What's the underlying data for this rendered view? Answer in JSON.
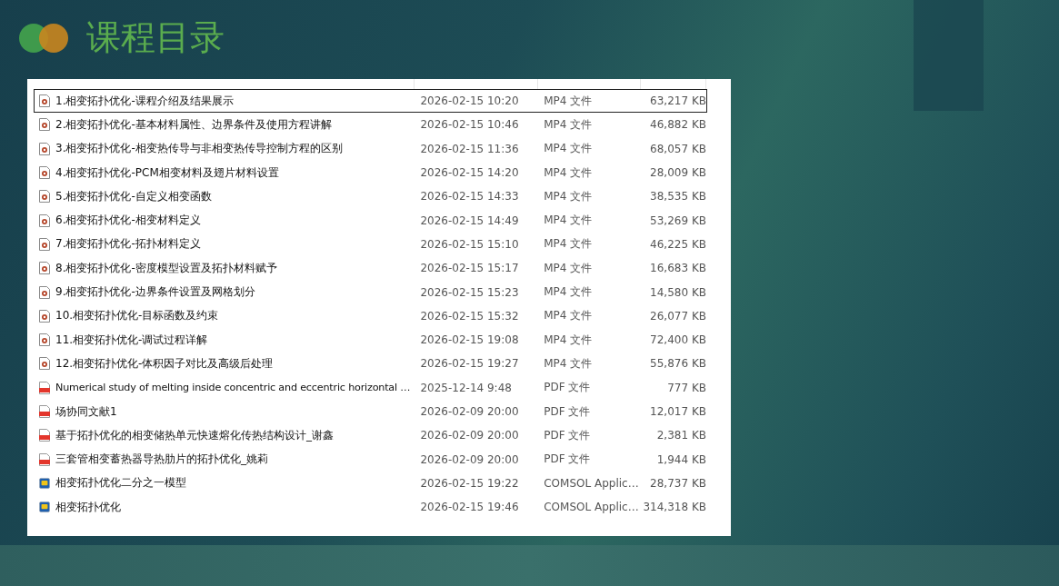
{
  "slide": {
    "title": "课程目录"
  },
  "file_list": {
    "rows": [
      {
        "kind": "mp4",
        "name": "1.相变拓扑优化-课程介绍及结果展示",
        "modified": "2026-02-15 10:20",
        "type": "MP4 文件",
        "size": "63,217 KB",
        "selected": true
      },
      {
        "kind": "mp4",
        "name": "2.相变拓扑优化-基本材料属性、边界条件及使用方程讲解",
        "modified": "2026-02-15 10:46",
        "type": "MP4 文件",
        "size": "46,882 KB",
        "selected": false
      },
      {
        "kind": "mp4",
        "name": "3.相变拓扑优化-相变热传导与非相变热传导控制方程的区别",
        "modified": "2026-02-15 11:36",
        "type": "MP4 文件",
        "size": "68,057 KB",
        "selected": false
      },
      {
        "kind": "mp4",
        "name": "4.相变拓扑优化-PCM相变材料及翅片材料设置",
        "modified": "2026-02-15 14:20",
        "type": "MP4 文件",
        "size": "28,009 KB",
        "selected": false
      },
      {
        "kind": "mp4",
        "name": "5.相变拓扑优化-自定义相变函数",
        "modified": "2026-02-15 14:33",
        "type": "MP4 文件",
        "size": "38,535 KB",
        "selected": false
      },
      {
        "kind": "mp4",
        "name": "6.相变拓扑优化-相变材料定义",
        "modified": "2026-02-15 14:49",
        "type": "MP4 文件",
        "size": "53,269 KB",
        "selected": false
      },
      {
        "kind": "mp4",
        "name": "7.相变拓扑优化-拓扑材料定义",
        "modified": "2026-02-15 15:10",
        "type": "MP4 文件",
        "size": "46,225 KB",
        "selected": false
      },
      {
        "kind": "mp4",
        "name": "8.相变拓扑优化-密度模型设置及拓扑材料赋予",
        "modified": "2026-02-15 15:17",
        "type": "MP4 文件",
        "size": "16,683 KB",
        "selected": false
      },
      {
        "kind": "mp4",
        "name": "9.相变拓扑优化-边界条件设置及网格划分",
        "modified": "2026-02-15 15:23",
        "type": "MP4 文件",
        "size": "14,580 KB",
        "selected": false
      },
      {
        "kind": "mp4",
        "name": "10.相变拓扑优化-目标函数及约束",
        "modified": "2026-02-15 15:32",
        "type": "MP4 文件",
        "size": "26,077 KB",
        "selected": false
      },
      {
        "kind": "mp4",
        "name": "11.相变拓扑优化-调试过程详解",
        "modified": "2026-02-15 19:08",
        "type": "MP4 文件",
        "size": "72,400 KB",
        "selected": false
      },
      {
        "kind": "mp4",
        "name": "12.相变拓扑优化-体积因子对比及高级后处理",
        "modified": "2026-02-15 19:27",
        "type": "MP4 文件",
        "size": "55,876 KB",
        "selected": false
      },
      {
        "kind": "pdf",
        "name": "Numerical study of melting inside concentric and eccentric horizontal …",
        "modified": "2025-12-14 9:48",
        "type": "PDF 文件",
        "size": "777 KB",
        "selected": false
      },
      {
        "kind": "pdf",
        "name": "场协同文献1",
        "modified": "2026-02-09 20:00",
        "type": "PDF 文件",
        "size": "12,017 KB",
        "selected": false
      },
      {
        "kind": "pdf",
        "name": "基于拓扑优化的相变储热单元快速熔化传热结构设计_谢鑫",
        "modified": "2026-02-09 20:00",
        "type": "PDF 文件",
        "size": "2,381 KB",
        "selected": false
      },
      {
        "kind": "pdf",
        "name": "三套管相变蓄热器导热肋片的拓扑优化_姚莉",
        "modified": "2026-02-09 20:00",
        "type": "PDF 文件",
        "size": "1,944 KB",
        "selected": false
      },
      {
        "kind": "comsol",
        "name": "相变拓扑优化二分之一模型",
        "modified": "2026-02-15 19:22",
        "type": "COMSOL Applic…",
        "size": "28,737 KB",
        "selected": false
      },
      {
        "kind": "comsol",
        "name": "相变拓扑优化",
        "modified": "2026-02-15 19:46",
        "type": "COMSOL Applic…",
        "size": "314,318 KB",
        "selected": false
      }
    ]
  }
}
